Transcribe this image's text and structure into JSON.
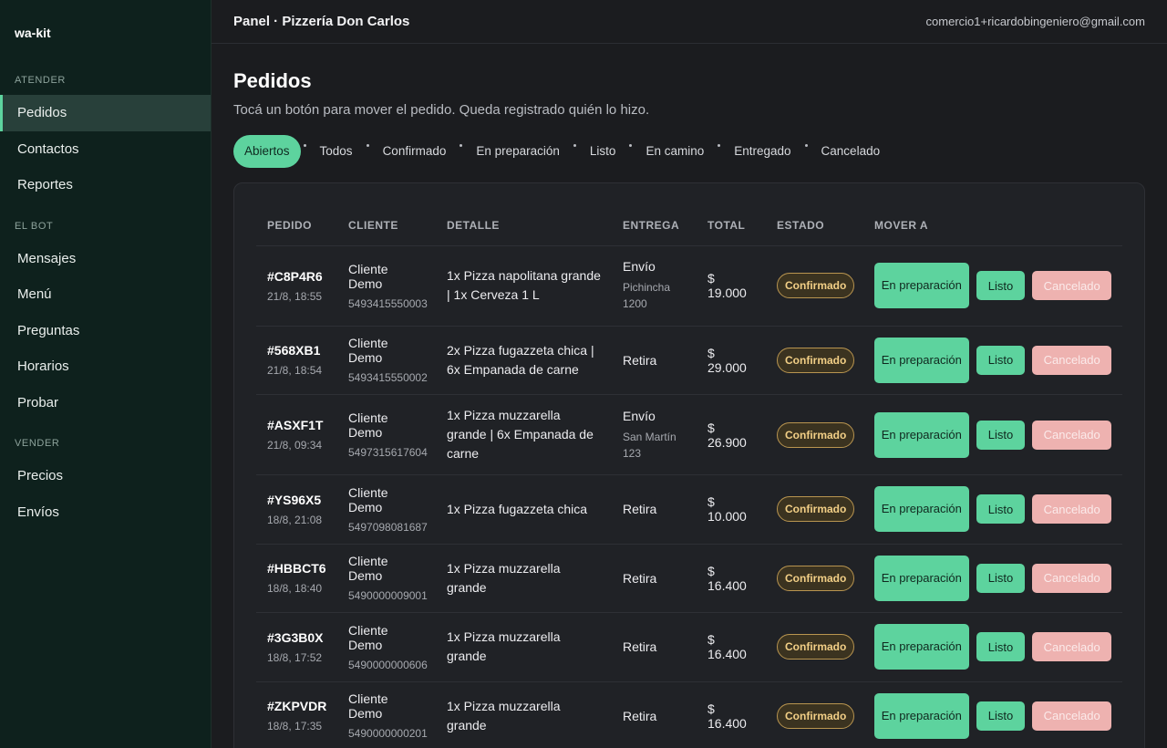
{
  "sidebar": {
    "brand": "wa-kit",
    "sections": [
      {
        "label": "ATENDER",
        "items": [
          "Pedidos",
          "Contactos",
          "Reportes"
        ]
      },
      {
        "label": "EL BOT",
        "items": [
          "Mensajes",
          "Menú",
          "Preguntas",
          "Horarios",
          "Probar"
        ]
      },
      {
        "label": "VENDER",
        "items": [
          "Precios",
          "Envíos"
        ]
      }
    ],
    "active_item": "Pedidos"
  },
  "topbar": {
    "title": "Panel · Pizzería Don Carlos",
    "user": "comercio1+ricardobingeniero@gmail.com"
  },
  "page": {
    "title": "Pedidos",
    "subtitle": "Tocá un botón para mover el pedido. Queda registrado quién lo hizo."
  },
  "filters": [
    "Abiertos",
    "Todos",
    "Confirmado",
    "En preparación",
    "Listo",
    "En camino",
    "Entregado",
    "Cancelado"
  ],
  "active_filter": "Abiertos",
  "table": {
    "headers": [
      "PEDIDO",
      "CLIENTE",
      "DETALLE",
      "ENTREGA",
      "TOTAL",
      "ESTADO",
      "MOVER A"
    ],
    "actions": {
      "prep": "En preparación",
      "listo": "Listo",
      "cancel": "Cancelado"
    },
    "rows": [
      {
        "id": "#C8P4R6",
        "date": "21/8, 18:55",
        "client": "Cliente Demo",
        "phone": "5493415550003",
        "detail": "1x Pizza napolitana grande | 1x Cerveza 1 L",
        "delivery": "Envío",
        "address": "Pichincha 1200",
        "total": "$ 19.000",
        "status": "Confirmado"
      },
      {
        "id": "#568XB1",
        "date": "21/8, 18:54",
        "client": "Cliente Demo",
        "phone": "5493415550002",
        "detail": "2x Pizza fugazzeta chica | 6x Empanada de carne",
        "delivery": "Retira",
        "address": "",
        "total": "$ 29.000",
        "status": "Confirmado"
      },
      {
        "id": "#ASXF1T",
        "date": "21/8, 09:34",
        "client": "Cliente Demo",
        "phone": "5497315617604",
        "detail": "1x Pizza muzzarella grande | 6x Empanada de carne",
        "delivery": "Envío",
        "address": "San Martín 123",
        "total": "$ 26.900",
        "status": "Confirmado"
      },
      {
        "id": "#YS96X5",
        "date": "18/8, 21:08",
        "client": "Cliente Demo",
        "phone": "5497098081687",
        "detail": "1x Pizza fugazzeta chica",
        "delivery": "Retira",
        "address": "",
        "total": "$ 10.000",
        "status": "Confirmado"
      },
      {
        "id": "#HBBCT6",
        "date": "18/8, 18:40",
        "client": "Cliente Demo",
        "phone": "5490000009001",
        "detail": "1x Pizza muzzarella grande",
        "delivery": "Retira",
        "address": "",
        "total": "$ 16.400",
        "status": "Confirmado"
      },
      {
        "id": "#3G3B0X",
        "date": "18/8, 17:52",
        "client": "Cliente Demo",
        "phone": "5490000000606",
        "detail": "1x Pizza muzzarella grande",
        "delivery": "Retira",
        "address": "",
        "total": "$ 16.400",
        "status": "Confirmado"
      },
      {
        "id": "#ZKPVDR",
        "date": "18/8, 17:35",
        "client": "Cliente Demo",
        "phone": "5490000000201",
        "detail": "1x Pizza muzzarella grande",
        "delivery": "Retira",
        "address": "",
        "total": "$ 16.400",
        "status": "Confirmado"
      }
    ]
  },
  "colors": {
    "accent": "#5dd39e",
    "sidebar_bg": "#0e211d",
    "status_confirmado": "#f2cf86",
    "cancel_button": "#eeb2b0"
  }
}
